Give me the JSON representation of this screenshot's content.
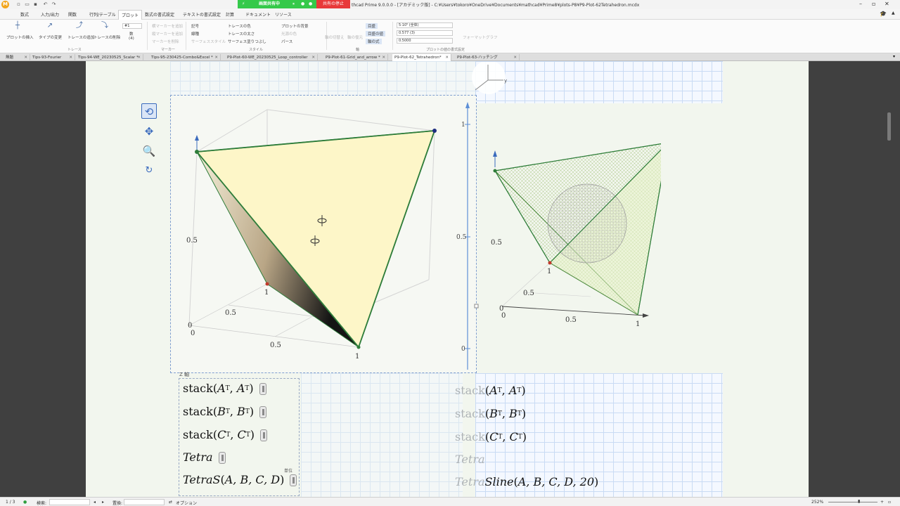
{
  "window": {
    "logo": "M",
    "sharing_label": "画面共有中",
    "stop_share_label": "共有の停止",
    "title": "thcad Prime 9.0.0.0 - [アカデミック版] - C:¥Users¥tokoro¥OneDrive¥Documents¥mathcad¥Prime8¥plots-P8¥P9-Plot-62Tetrahedron.mcdx"
  },
  "ribbon_tabs": [
    "数式",
    "入力/出力",
    "関数",
    "行列/テーブル",
    "プロット",
    "数式の書式設定",
    "テキストの書式設定",
    "計算",
    "ドキュメント",
    "リソース"
  ],
  "active_tab": "プロット",
  "ribbon": {
    "insert_plot": "プロットの挿入",
    "change_type": "タイプの変更",
    "add_trace": "トレースの追加",
    "delete_trace": "トレースの削除",
    "trace_group": "トレース",
    "trace_count_value": "#1",
    "trace_count_label": "数",
    "trace_count_sub": "(4)",
    "marker_add_h": "横マーカーを追加",
    "marker_add_v": "縦マーカーを追加",
    "marker_delete": "マーカーを削除",
    "marker_group": "マーカー",
    "symbol": "記号",
    "line_style": "線種",
    "surface_style": "サーフェススタイル",
    "trace_color": "トレースの色",
    "trace_weight": "トレースの太さ",
    "surface_fill": "サーフェス塗りつぶし",
    "plot_bg": "プロットの背景",
    "ambient_color": "光源の色",
    "perspective": "パース",
    "style_group": "スタイル",
    "axis_toggle": "軸の切替え",
    "axis_reset": "軸の復元",
    "axis_style_a": "目盛",
    "axis_style_b": "目盛の値",
    "axis_style_c": "軸の式",
    "axis_group": "軸",
    "format_value_1": "5·10⁵ (全体)",
    "format_value_2": "0.577 (3)",
    "format_value_3": "0.5000",
    "format_group": "プロットの値の書式設定",
    "format_graph": "フォーマットグラフ"
  },
  "doc_tabs": [
    {
      "label": "無題"
    },
    {
      "label": "Tips-93-Fourier"
    },
    {
      "label": "Tips-94-WE_20230525_Scalar *"
    },
    {
      "label": "Tips-95-230425-Combo&Excel *"
    },
    {
      "label": "P9-Plot-60-WE_20230525_Loop_controller"
    },
    {
      "label": "P9-Plot-61-Grid_and_arrow *"
    },
    {
      "label": "P9-Plot-62_Tetrahedron*"
    },
    {
      "label": "P9-Plot-63-ハッチング"
    }
  ],
  "active_doc_tab": "P9-Plot-62_Tetrahedron*",
  "plot1": {
    "z_tick": "0.5",
    "x_ticks": [
      "0",
      "0.5",
      "1"
    ],
    "y_ticks": [
      "0",
      "0.5",
      "1"
    ],
    "mid_ticks": [
      "1",
      "0.5",
      "0"
    ]
  },
  "plot2": {
    "z_tick": "0.5",
    "x_ticks": [
      "0",
      "0.5",
      "1"
    ],
    "y_ticks": [
      "0",
      "0.5",
      "1"
    ]
  },
  "orientation_axis_label": "y",
  "z_axis_label": "Z 軸",
  "unit_label": "単位",
  "expressions_left": [
    {
      "fn": "stack",
      "a": "A",
      "b": "A"
    },
    {
      "fn": "stack",
      "a": "B",
      "b": "B"
    },
    {
      "fn": "stack",
      "a": "C",
      "b": "C"
    }
  ],
  "expressions_right": [
    {
      "fn": "stack",
      "a": "A",
      "b": "A"
    },
    {
      "fn": "stack",
      "a": "B",
      "b": "B"
    },
    {
      "fn": "stack",
      "a": "C",
      "b": "C"
    }
  ],
  "tetra_label": "Tetra",
  "tetraS_label": "TetraS",
  "tetraS_args": "A, B, C, D",
  "tetraSline_label": "TetraSline",
  "tetraSline_args": "A, B, C, D, 20",
  "transpose_mark": "T",
  "status": {
    "page": "1 / 3",
    "search_label": "検索:",
    "replace_label": "置換:",
    "options_label": "オプション",
    "zoom": "252%"
  },
  "colors": {
    "accent": "#3b6bbd",
    "face_fill": "#fdf6c8",
    "edge": "#2e7d3a",
    "share_green": "#35c94a",
    "share_red": "#e8393a"
  }
}
